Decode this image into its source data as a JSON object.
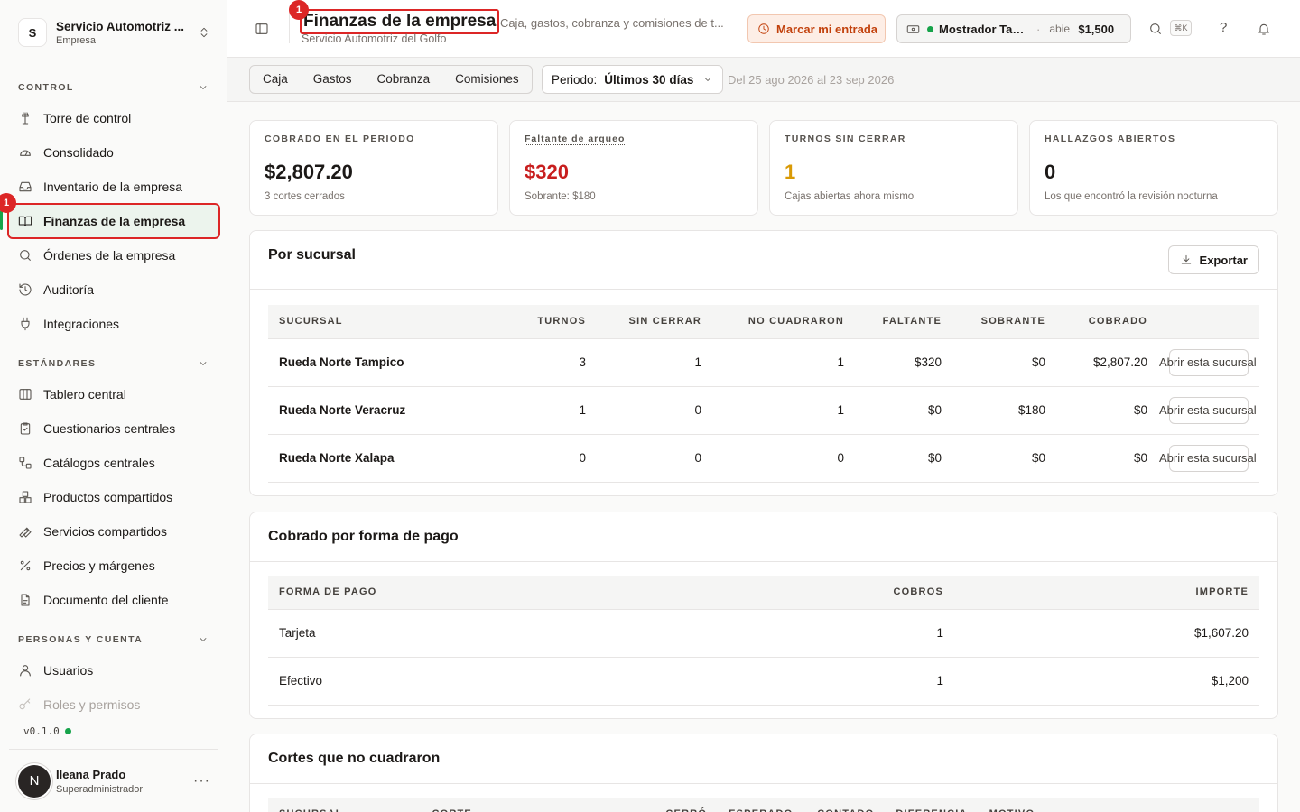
{
  "workspace": {
    "initial": "S",
    "name": "Servicio Automotriz ...",
    "type": "Empresa"
  },
  "sidebar": {
    "sections": [
      {
        "label": "CONTROL",
        "items": [
          {
            "label": "Torre de control",
            "icon": "tower-icon"
          },
          {
            "label": "Consolidado",
            "icon": "gauge-icon"
          },
          {
            "label": "Inventario de la empresa",
            "icon": "inbox-icon"
          },
          {
            "label": "Finanzas de la empresa",
            "icon": "book-icon",
            "active": true
          },
          {
            "label": "Órdenes de la empresa",
            "icon": "search-icon"
          },
          {
            "label": "Auditoría",
            "icon": "history-icon"
          },
          {
            "label": "Integraciones",
            "icon": "plug-icon"
          }
        ]
      },
      {
        "label": "ESTÁNDARES",
        "items": [
          {
            "label": "Tablero central",
            "icon": "columns-icon"
          },
          {
            "label": "Cuestionarios centrales",
            "icon": "clipboard-icon"
          },
          {
            "label": "Catálogos centrales",
            "icon": "workflow-icon"
          },
          {
            "label": "Productos compartidos",
            "icon": "boxes-icon"
          },
          {
            "label": "Servicios compartidos",
            "icon": "wrench-icon"
          },
          {
            "label": "Precios y márgenes",
            "icon": "percent-icon"
          },
          {
            "label": "Documento del cliente",
            "icon": "file-icon"
          }
        ]
      },
      {
        "label": "PERSONAS Y CUENTA",
        "items": [
          {
            "label": "Usuarios",
            "icon": "user-icon"
          },
          {
            "label": "Roles y permisos",
            "icon": "key-icon"
          }
        ]
      }
    ],
    "version": "v0.1.0",
    "user": {
      "initial": "N",
      "name": "Ileana Prado",
      "role": "Superadministrador",
      "more": "···"
    }
  },
  "annotation_badge": "1",
  "header": {
    "title": "Finanzas de la empresa",
    "subtitle": "Servicio Automotriz del Golfo",
    "description": "· Caja, gastos, cobranza y comisiones de t...",
    "clock_button": "Marcar mi entrada",
    "register": {
      "name": "Mostrador Tampi...",
      "separator": "·",
      "state": "abie",
      "amount": "$1,500"
    },
    "shortcut": "⌘K",
    "help": "?"
  },
  "toolbar": {
    "tabs": [
      "Caja",
      "Gastos",
      "Cobranza",
      "Comisiones"
    ],
    "period_label": "Periodo:",
    "period_value": "Últimos 30 días",
    "range": "Del 25 ago 2026 al 23 sep 2026"
  },
  "kpis": [
    {
      "label": "COBRADO EN EL PERIODO",
      "value": "$2,807.20",
      "sub": "3 cortes cerrados",
      "color": "#1c1917"
    },
    {
      "label": "Faltante de arqueo",
      "value": "$320",
      "sub": "Sobrante: $180",
      "color": "#c81e1e"
    },
    {
      "label": "TURNOS SIN CERRAR",
      "value": "1",
      "sub": "Cajas abiertas ahora mismo",
      "color": "#d99a06"
    },
    {
      "label": "HALLAZGOS ABIERTOS",
      "value": "0",
      "sub": "Los que encontró la revisión nocturna",
      "color": "#1c1917"
    }
  ],
  "branches": {
    "title": "Por sucursal",
    "export_label": "Exportar",
    "columns": [
      "SUCURSAL",
      "TURNOS",
      "SIN CERRAR",
      "NO CUADRARON",
      "FALTANTE",
      "SOBRANTE",
      "COBRADO"
    ],
    "rows": [
      {
        "name": "Rueda Norte Tampico",
        "turnos": "3",
        "sin_cerrar": "1",
        "no_cuadraron": "1",
        "faltante": "$320",
        "sobrante": "$0",
        "cobrado": "$2,807.20",
        "action": "Abrir esta sucursal"
      },
      {
        "name": "Rueda Norte Veracruz",
        "turnos": "1",
        "sin_cerrar": "0",
        "no_cuadraron": "1",
        "faltante": "$0",
        "sobrante": "$180",
        "cobrado": "$0",
        "action": "Abrir esta sucursal"
      },
      {
        "name": "Rueda Norte Xalapa",
        "turnos": "0",
        "sin_cerrar": "0",
        "no_cuadraron": "0",
        "faltante": "$0",
        "sobrante": "$0",
        "cobrado": "$0",
        "action": "Abrir esta sucursal"
      }
    ]
  },
  "payments": {
    "title": "Cobrado por forma de pago",
    "columns": [
      "FORMA DE PAGO",
      "COBROS",
      "IMPORTE"
    ],
    "rows": [
      {
        "method": "Tarjeta",
        "count": "1",
        "amount": "$1,607.20"
      },
      {
        "method": "Efectivo",
        "count": "1",
        "amount": "$1,200"
      }
    ]
  },
  "mismatch": {
    "title": "Cortes que no cuadraron",
    "columns": [
      "SUCURSAL",
      "CORTE",
      "CERRÓ",
      "ESPERADO",
      "CONTADO",
      "DIFERENCIA",
      "MOTIVO"
    ]
  }
}
